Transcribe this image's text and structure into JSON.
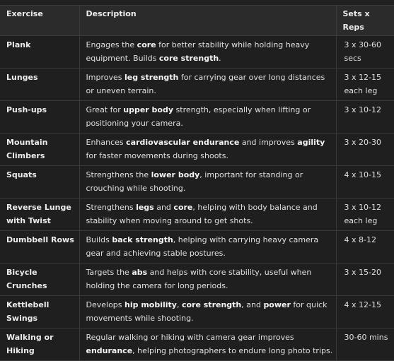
{
  "table": {
    "headers": {
      "exercise": "Exercise",
      "description": "Description",
      "sets": "Sets x Reps"
    },
    "rows": [
      {
        "exercise": "Plank",
        "description": [
          {
            "t": "Engages the "
          },
          {
            "t": "core",
            "b": true
          },
          {
            "t": " for better stability while holding heavy equipment. Builds "
          },
          {
            "t": "core strength",
            "b": true
          },
          {
            "t": "."
          }
        ],
        "sets": "3 x 30-60 secs"
      },
      {
        "exercise": "Lunges",
        "description": [
          {
            "t": "Improves "
          },
          {
            "t": "leg strength",
            "b": true
          },
          {
            "t": " for carrying gear over long distances or uneven terrain."
          }
        ],
        "sets": "3 x 12-15 each leg"
      },
      {
        "exercise": "Push-ups",
        "description": [
          {
            "t": "Great for "
          },
          {
            "t": "upper body",
            "b": true
          },
          {
            "t": " strength, especially when lifting or positioning your camera."
          }
        ],
        "sets": "3 x 10-12"
      },
      {
        "exercise": "Mountain Climbers",
        "description": [
          {
            "t": "Enhances "
          },
          {
            "t": "cardiovascular endurance",
            "b": true
          },
          {
            "t": " and improves "
          },
          {
            "t": "agility",
            "b": true
          },
          {
            "t": " for faster movements during shoots."
          }
        ],
        "sets": "3 x 20-30"
      },
      {
        "exercise": "Squats",
        "description": [
          {
            "t": "Strengthens the "
          },
          {
            "t": "lower body",
            "b": true
          },
          {
            "t": ", important for standing or crouching while shooting."
          }
        ],
        "sets": "4 x 10-15"
      },
      {
        "exercise": "Reverse Lunge with Twist",
        "description": [
          {
            "t": "Strengthens "
          },
          {
            "t": "legs",
            "b": true
          },
          {
            "t": " and "
          },
          {
            "t": "core",
            "b": true
          },
          {
            "t": ", helping with body balance and stability when moving around to get shots."
          }
        ],
        "sets": "3 x 10-12 each leg"
      },
      {
        "exercise": "Dumbbell Rows",
        "description": [
          {
            "t": "Builds "
          },
          {
            "t": "back strength",
            "b": true
          },
          {
            "t": ", helping with carrying heavy camera gear and achieving stable postures."
          }
        ],
        "sets": "4 x 8-12"
      },
      {
        "exercise": "Bicycle Crunches",
        "description": [
          {
            "t": "Targets the "
          },
          {
            "t": "abs",
            "b": true
          },
          {
            "t": " and helps with core stability, useful when holding the camera for long periods."
          }
        ],
        "sets": "3 x 15-20"
      },
      {
        "exercise": "Kettlebell Swings",
        "description": [
          {
            "t": "Develops "
          },
          {
            "t": "hip mobility",
            "b": true
          },
          {
            "t": ", "
          },
          {
            "t": "core strength",
            "b": true
          },
          {
            "t": ", and "
          },
          {
            "t": "power",
            "b": true
          },
          {
            "t": " for quick movements while shooting."
          }
        ],
        "sets": "4 x 12-15"
      },
      {
        "exercise": "Walking or Hiking",
        "description": [
          {
            "t": "Regular walking or hiking with camera gear improves "
          },
          {
            "t": "endurance",
            "b": true
          },
          {
            "t": ", helping photographers to endure long photo trips."
          }
        ],
        "sets": "30-60 mins"
      }
    ]
  }
}
